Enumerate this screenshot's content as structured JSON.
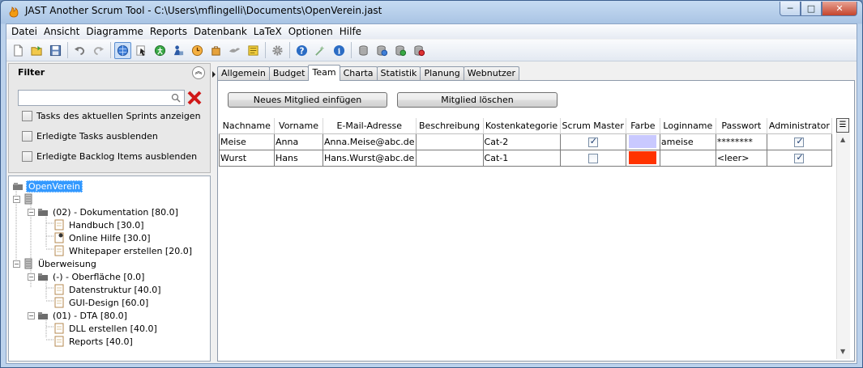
{
  "window": {
    "title": "JAST Another Scrum Tool  -  C:\\Users\\mflingelli\\Documents\\OpenVerein.jast",
    "minimize": "─",
    "maximize": "□",
    "close": "✕"
  },
  "menu": [
    "Datei",
    "Ansicht",
    "Diagramme",
    "Reports",
    "Datenbank",
    "LaTeX",
    "Optionen",
    "Hilfe"
  ],
  "toolbar_icons": [
    "new-file-icon",
    "open-folder-icon",
    "save-icon",
    "undo-icon",
    "redo-icon",
    "globe-icon",
    "cursor-icon",
    "run-icon",
    "person-icon",
    "clock-icon",
    "bag-icon",
    "bird-icon",
    "notes-icon",
    "gear-icon",
    "help-icon",
    "wizard-icon",
    "info-icon",
    "database-icon",
    "database-globe-icon",
    "database-add-icon",
    "database-remove-icon"
  ],
  "filter": {
    "title": "Filter",
    "collapse": "︽",
    "search_value": "",
    "checkboxes": [
      "Tasks des aktuellen Sprints anzeigen",
      "Erledigte Tasks ausblenden",
      "Erledigte Backlog Items ausblenden"
    ]
  },
  "tree": [
    {
      "label": "OpenVerein",
      "level": 0,
      "icon": "project",
      "selected": true
    },
    {
      "label": "",
      "level": 1,
      "icon": "backlog",
      "expander": "−"
    },
    {
      "label": "(02) - Dokumentation [80.0]",
      "level": 2,
      "icon": "folder",
      "expander": "−"
    },
    {
      "label": "Handbuch [30.0]",
      "level": 3,
      "icon": "task"
    },
    {
      "label": "Online Hilfe [30.0]",
      "level": 3,
      "icon": "task-active"
    },
    {
      "label": "Whitepaper erstellen [20.0]",
      "level": 3,
      "icon": "task"
    },
    {
      "label": "Überweisung",
      "level": 1,
      "icon": "backlog",
      "expander": "−"
    },
    {
      "label": "(-) - Oberfläche [0.0]",
      "level": 2,
      "icon": "folder",
      "expander": "−"
    },
    {
      "label": "Datenstruktur [40.0]",
      "level": 3,
      "icon": "task"
    },
    {
      "label": "GUI-Design [60.0]",
      "level": 3,
      "icon": "task"
    },
    {
      "label": "(01) - DTA [80.0]",
      "level": 2,
      "icon": "folder",
      "expander": "−"
    },
    {
      "label": "DLL erstellen [40.0]",
      "level": 3,
      "icon": "task"
    },
    {
      "label": "Reports [40.0]",
      "level": 3,
      "icon": "task"
    }
  ],
  "tabs": [
    "Allgemein",
    "Budget",
    "Team",
    "Charta",
    "Statistik",
    "Planung",
    "Webnutzer"
  ],
  "active_tab": "Team",
  "buttons": {
    "add_member": "Neues Mitglied einfügen",
    "delete_member": "Mitglied löschen"
  },
  "table": {
    "columns": [
      "Nachname",
      "Vorname",
      "E-Mail-Adresse",
      "Beschreibung",
      "Kostenkategorie",
      "Scrum Master",
      "Farbe",
      "Loginname",
      "Passwort",
      "Administrator"
    ],
    "rows": [
      {
        "Nachname": "Meise",
        "Vorname": "Anna",
        "Email": "Anna.Meise@abc.de",
        "Beschreibung": "",
        "Kostenkategorie": "Cat-2",
        "ScrumMaster": true,
        "Farbe": "#c9c9ff",
        "Loginname": "ameise",
        "Passwort": "********",
        "Administrator": true
      },
      {
        "Nachname": "Wurst",
        "Vorname": "Hans",
        "Email": "Hans.Wurst@abc.de",
        "Beschreibung": "",
        "Kostenkategorie": "Cat-1",
        "ScrumMaster": false,
        "Farbe": "#ff3300",
        "Loginname": "",
        "Passwort": "<leer>",
        "Administrator": true
      }
    ]
  },
  "scroll": {
    "up": "▲",
    "down": "▼"
  },
  "column_menu_icon": "column-menu-icon"
}
